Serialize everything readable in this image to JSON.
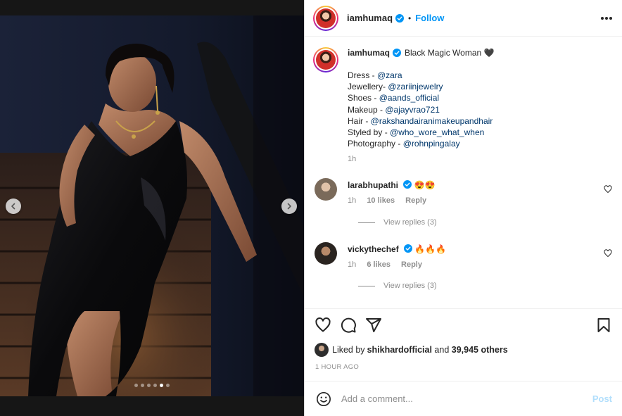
{
  "header": {
    "username": "iamhumaq",
    "separator": "•",
    "follow_label": "Follow"
  },
  "caption": {
    "username": "iamhumaq",
    "title": "Black Magic Woman 🖤",
    "credits": [
      {
        "label": "Dress - ",
        "handle": "@zara"
      },
      {
        "label": "Jewellery- ",
        "handle": "@zariinjewelry"
      },
      {
        "label": "Shoes - ",
        "handle": "@aands_official"
      },
      {
        "label": "Makeup - ",
        "handle": "@ajayvrao721"
      },
      {
        "label": "Hair - ",
        "handle": "@rakshandairanimakeupandhair"
      },
      {
        "label": "Styled by - ",
        "handle": "@who_wore_what_when"
      },
      {
        "label": "Photography - ",
        "handle": "@rohnpingalay"
      }
    ],
    "time": "1h"
  },
  "comments": [
    {
      "username": "larabhupathi",
      "text": "😍😍",
      "time": "1h",
      "likes": "10 likes",
      "reply_label": "Reply",
      "view_replies": "View replies (3)"
    },
    {
      "username": "vickythechef",
      "text": "🔥🔥🔥",
      "time": "1h",
      "likes": "6 likes",
      "reply_label": "Reply",
      "view_replies": "View replies (3)"
    }
  ],
  "likes": {
    "prefix": "Liked by ",
    "user": "shikhardofficial",
    "middle": " and ",
    "others": "39,945 others"
  },
  "post_time": "1 HOUR AGO",
  "add_comment": {
    "placeholder": "Add a comment...",
    "post_label": "Post"
  },
  "carousel": {
    "total_slides": 6,
    "active_slide": 5
  },
  "colors": {
    "accent": "#0095f6",
    "link": "#00376b",
    "muted": "#8e8e8e",
    "verified": "#0095f6"
  },
  "icons": {
    "nav_prev": "chevron-left-icon",
    "nav_next": "chevron-right-icon",
    "more": "more-options-icon",
    "like": "heart-icon",
    "comment": "comment-icon",
    "share": "paper-plane-icon",
    "save": "bookmark-icon",
    "emoji": "emoji-icon"
  }
}
